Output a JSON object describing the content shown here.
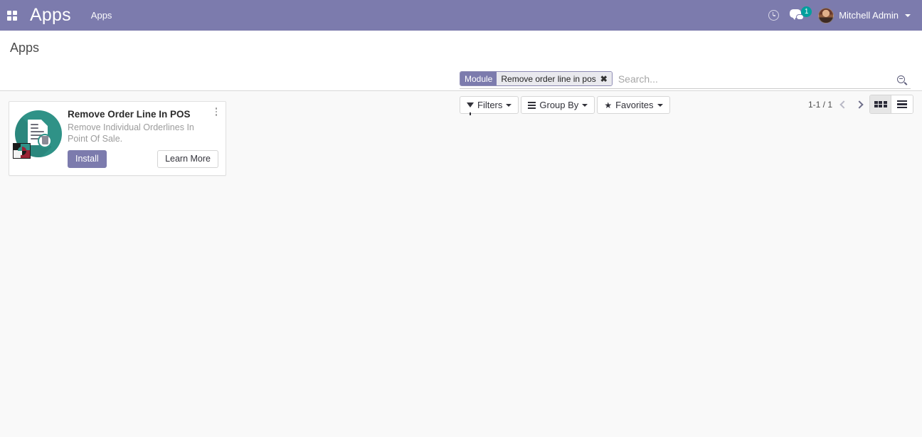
{
  "navbar": {
    "apps_launcher_icon": "grid-icon",
    "brand": "Apps",
    "menu_items": [
      {
        "label": "Apps"
      }
    ],
    "activity_icon": "clock-icon",
    "messages_icon": "messages-icon",
    "messages_badge": "1",
    "user_name": "Mitchell Admin",
    "accent_color": "#7c7bad",
    "badge_color": "#00a09d"
  },
  "control_panel": {
    "breadcrumb": "Apps",
    "search": {
      "facet_label": "Module",
      "facet_value": "Remove order line in pos",
      "facet_remove_icon": "close-icon",
      "placeholder": "Search...",
      "value": "",
      "search_icon": "search-icon"
    },
    "buttons": [
      {
        "label": "Filters",
        "icon": "funnel-icon"
      },
      {
        "label": "Group By",
        "icon": "list-lines-icon"
      },
      {
        "label": "Favorites",
        "icon": "star-icon"
      }
    ],
    "pager": {
      "value": "1-1 / 1",
      "prev_icon": "chevron-left-icon",
      "next_icon": "chevron-right-icon"
    },
    "views": [
      {
        "name": "kanban",
        "icon": "kanban-icon",
        "active": true
      },
      {
        "name": "list",
        "icon": "list-icon",
        "active": false
      }
    ]
  },
  "content": {
    "cards": [
      {
        "title": "Remove Order Line In POS",
        "description": "Remove Individual Orderlines In Point Of Sale.",
        "install_label": "Install",
        "learn_more_label": "Learn More",
        "icon": "document-trash-icon",
        "publisher_badge_icon": "publisher-logo-icon",
        "menu_icon": "kebab-menu-icon",
        "icon_color": "#2f9287"
      }
    ]
  }
}
